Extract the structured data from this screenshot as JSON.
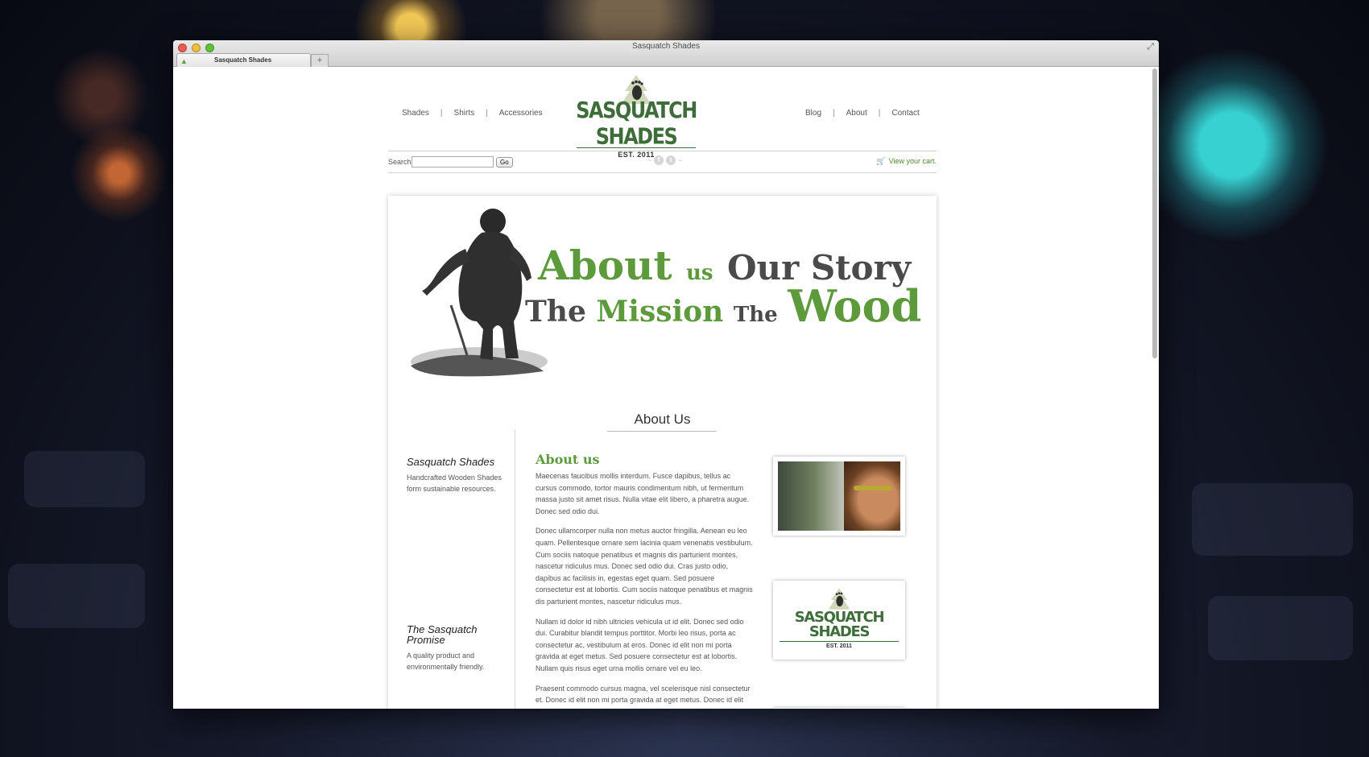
{
  "window": {
    "title": "Sasquatch Shades"
  },
  "tab": {
    "label": "Sasquatch Shades",
    "new_tab": "+"
  },
  "nav": {
    "left": [
      "Shades",
      "Shirts",
      "Accessories"
    ],
    "right": [
      "Blog",
      "About",
      "Contact"
    ],
    "separator": "|"
  },
  "logo": {
    "name": "SASQUATCH SHADES",
    "est": "EST. 2011"
  },
  "search": {
    "label": "Search",
    "value": "",
    "button": "Go"
  },
  "social": {
    "facebook": "f",
    "twitter": "t"
  },
  "cart": {
    "label": "View your cart."
  },
  "hero": {
    "word_about": "About",
    "word_us": "us",
    "word_our_story": "Our Story",
    "word_the1": "The",
    "word_mission": "Mission",
    "word_the2": "The",
    "word_wood": "Wood"
  },
  "section": {
    "title": "About Us"
  },
  "sidebar": [
    {
      "title": "Sasquatch Shades",
      "text": "Handcrafted Wooden Shades form sustainable resources."
    },
    {
      "title": "The Sasquatch Promise",
      "text": "A quality product and environmentally friendly."
    }
  ],
  "article": {
    "heading": "About us",
    "paragraphs": [
      "Maecenas faucibus mollis interdum. Fusce dapibus, tellus ac cursus commodo, tortor mauris condimentum nibh, ut fermentum massa justo sit amet risus. Nulla vitae elit libero, a pharetra augue. Donec sed odio dui.",
      "Donec ullamcorper nulla non metus auctor fringilla. Aenean eu leo quam. Pellentesque ornare sem lacinia quam venenatis vestibulum. Cum sociis natoque penatibus et magnis dis parturient montes, nascetur ridiculus mus. Donec sed odio dui. Cras justo odio, dapibus ac facilisis in, egestas eget quam. Sed posuere consectetur est at lobortis. Cum sociis natoque penatibus et magnis dis parturient montes, nascetur ridiculus mus.",
      "Nullam id dolor id nibh ultricies vehicula ut id elit. Donec sed odio dui. Curabitur blandit tempus porttitor. Morbi leo risus, porta ac consectetur ac, vestibulum at eros. Donec id elit non mi porta gravida at eget metus. Sed posuere consectetur est at lobortis. Nullam quis risus eget urna mollis ornare vel eu leo.",
      "Praesent commodo cursus magna, vel scelerisque nisl consectetur et. Donec id elit non mi porta gravida at eget metus. Donec id elit non mi porta gravida at eget metus. Nullam quis risus eget urna mollis ornare"
    ]
  },
  "colors": {
    "accent": "#5d9a3c",
    "logo_green": "#3e6d3a"
  }
}
